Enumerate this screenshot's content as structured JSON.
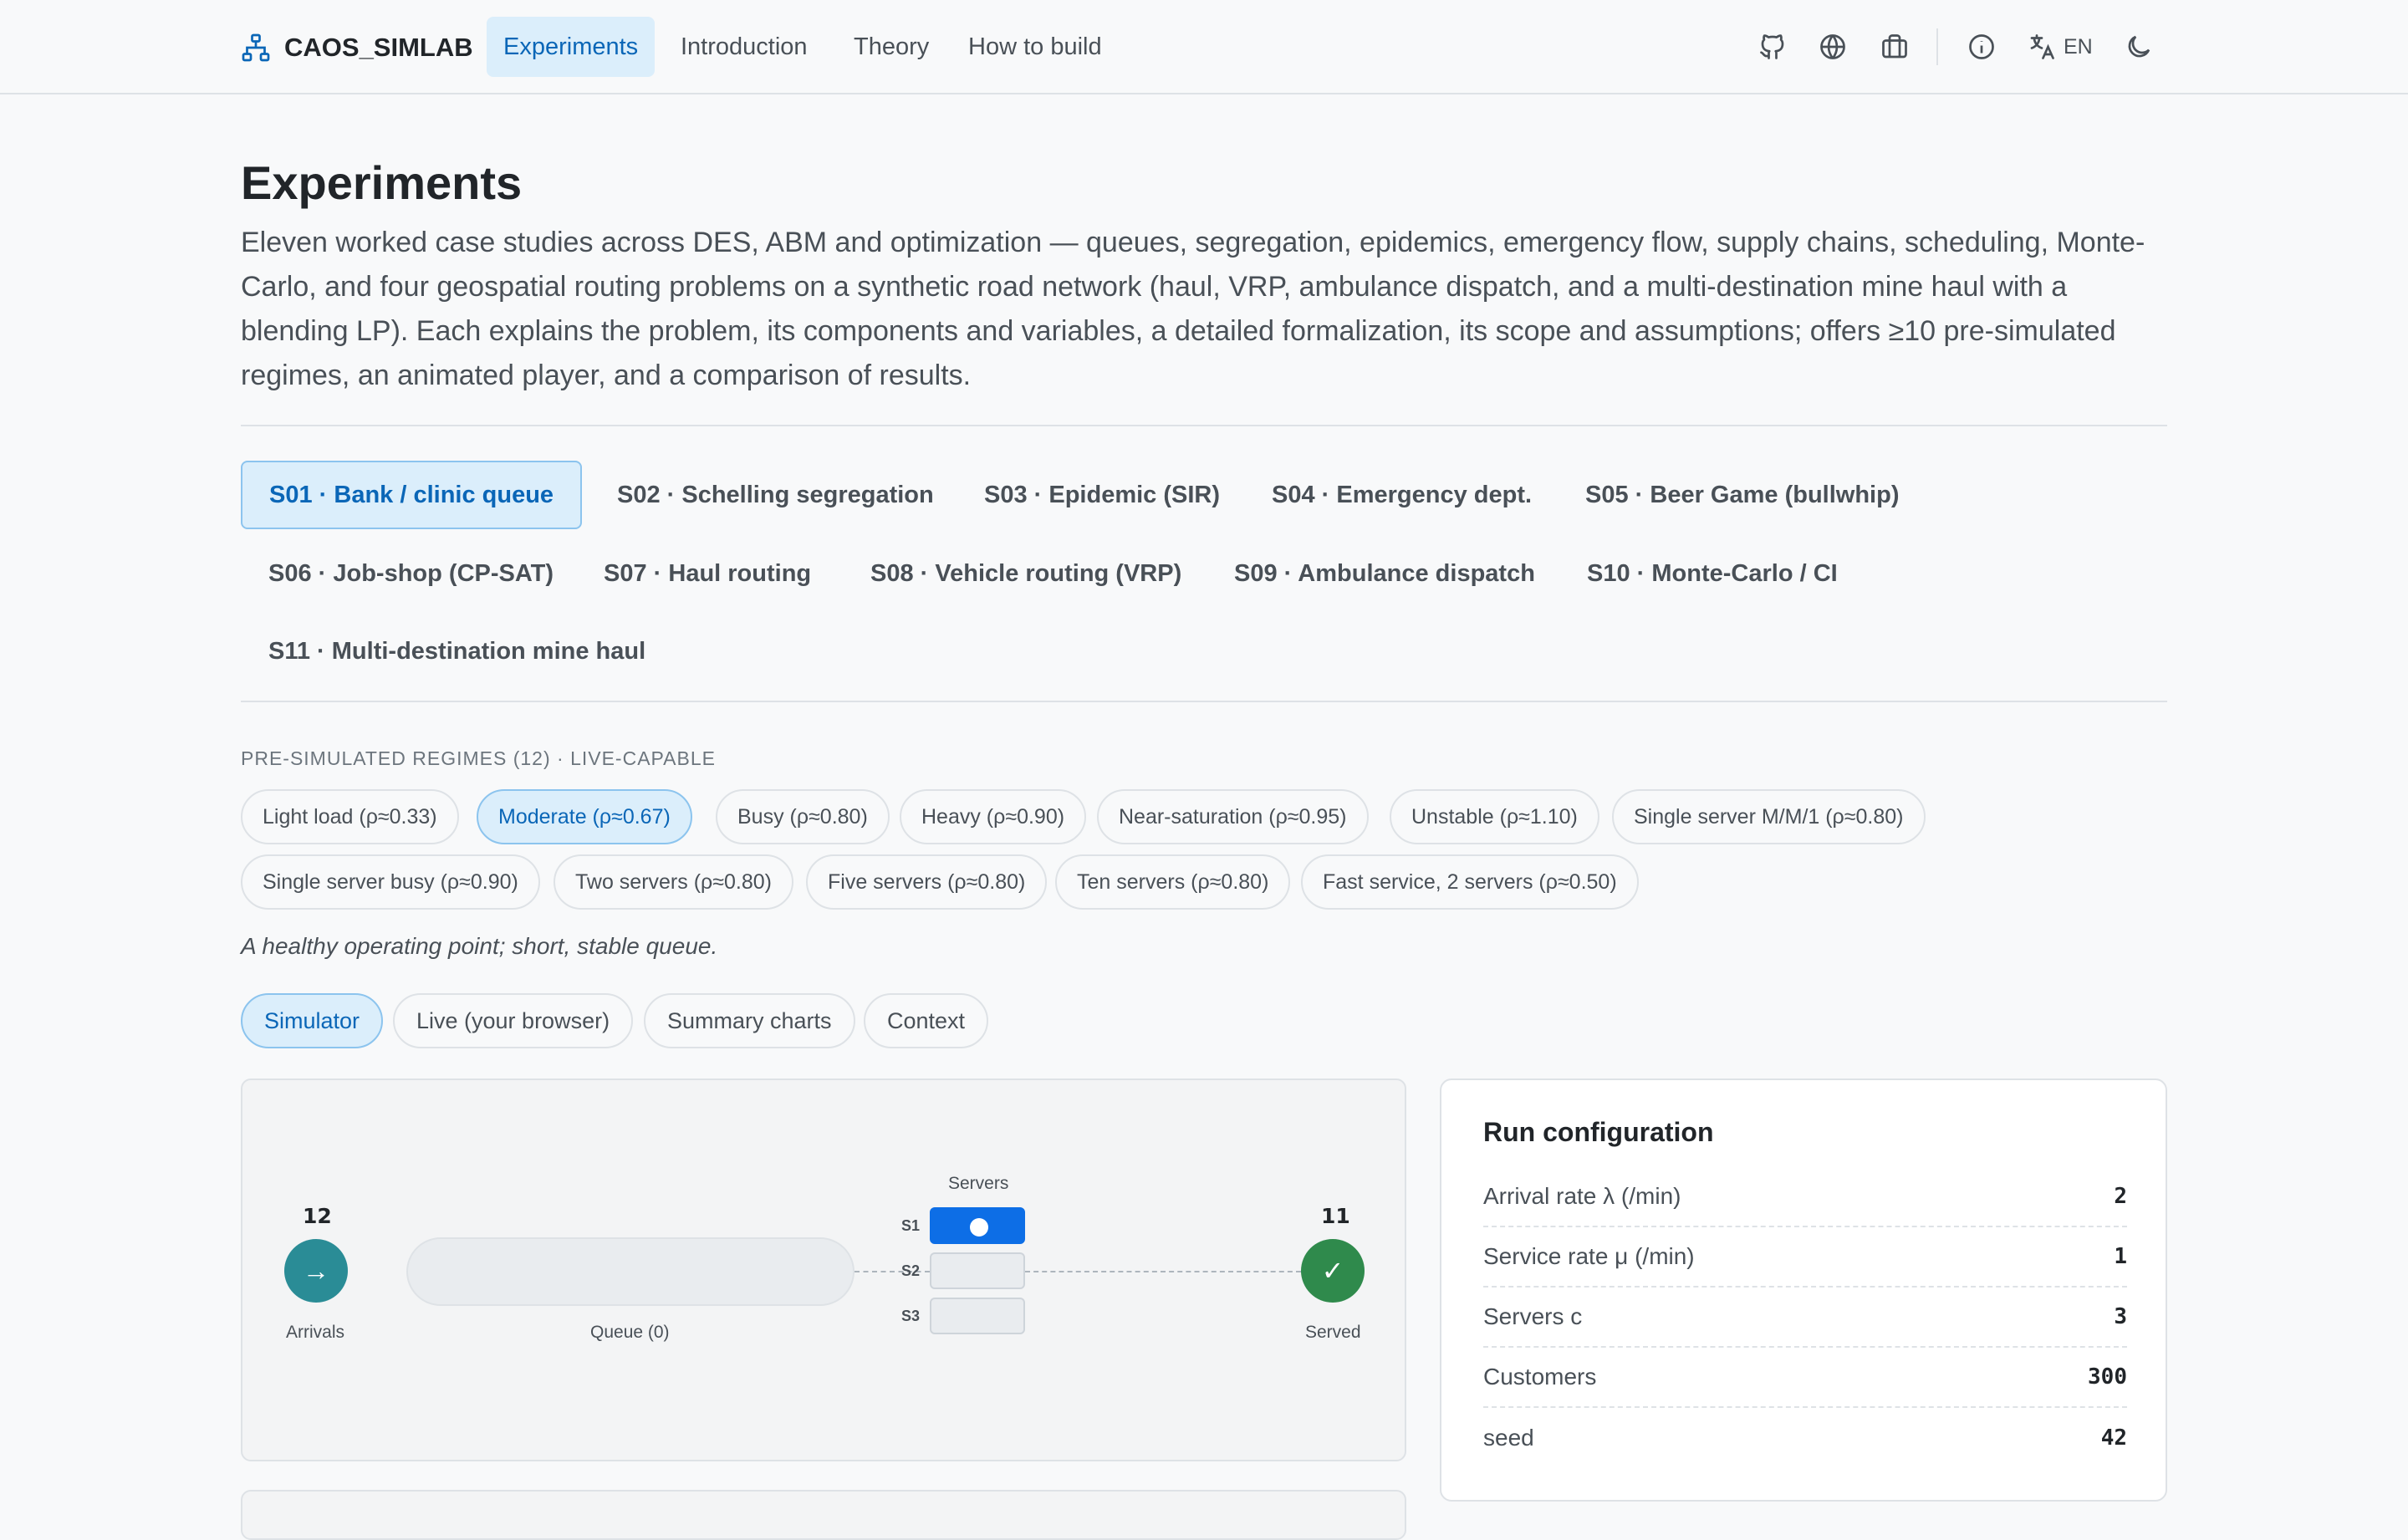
{
  "nav": {
    "brand": "CAOS_SIMLAB",
    "links": [
      "Experiments",
      "Introduction",
      "Theory",
      "How to build"
    ],
    "active_link": "Experiments",
    "icons": [
      "github-icon",
      "globe-icon",
      "briefcase-icon",
      "info-icon",
      "translate-icon",
      "moon-icon"
    ],
    "language": "EN"
  },
  "header": {
    "title": "Experiments",
    "intro": "Eleven worked case studies across DES, ABM and optimization — queues, segregation, epidemics, emergency flow, supply chains, scheduling, Monte-Carlo, and four geospatial routing problems on a synthetic road network (haul, VRP, ambulance dispatch, and a multi-destination mine haul with a blending LP). Each explains the problem, its components and variables, a detailed formalization, its scope and assumptions; offers ≥10 pre-simulated regimes, an animated player, and a comparison of results."
  },
  "scenarios": [
    "S01 · Bank / clinic queue",
    "S02 · Schelling segregation",
    "S03 · Epidemic (SIR)",
    "S04 · Emergency dept.",
    "S05 · Beer Game (bullwhip)",
    "S06 · Job-shop (CP-SAT)",
    "S07 · Haul routing",
    "S08 · Vehicle routing (VRP)",
    "S09 · Ambulance dispatch",
    "S10 · Monte-Carlo / CI",
    "S11 · Multi-destination mine haul"
  ],
  "active_scenario": "S01 · Bank / clinic queue",
  "regimes": {
    "label": "PRE-SIMULATED REGIMES (12) · LIVE-CAPABLE",
    "items": [
      "Light load (ρ≈0.33)",
      "Moderate (ρ≈0.67)",
      "Busy (ρ≈0.80)",
      "Heavy (ρ≈0.90)",
      "Near-saturation (ρ≈0.95)",
      "Unstable (ρ≈1.10)",
      "Single server M/M/1 (ρ≈0.80)",
      "Single server busy (ρ≈0.90)",
      "Two servers (ρ≈0.80)",
      "Five servers (ρ≈0.80)",
      "Ten servers (ρ≈0.80)",
      "Fast service, 2 servers (ρ≈0.50)"
    ],
    "active": "Moderate (ρ≈0.67)",
    "description": "A healthy operating point; short, stable queue."
  },
  "view_tabs": [
    "Simulator",
    "Live (your browser)",
    "Summary charts",
    "Context"
  ],
  "active_view_tab": "Simulator",
  "simulator": {
    "arrivals_count": "12",
    "arrivals_label": "Arrivals",
    "arrivals_icon": "→",
    "queue_label": "Queue (0)",
    "servers_title": "Servers",
    "servers": [
      {
        "label": "S1",
        "busy": true
      },
      {
        "label": "S2",
        "busy": false
      },
      {
        "label": "S3",
        "busy": false
      }
    ],
    "served_count": "11",
    "served_label": "Served",
    "served_icon": "✓",
    "colors": {
      "arrivals": "#2a8c96",
      "served": "#2f8a4c",
      "busy_server": "#0d6ee6"
    }
  },
  "run_config": {
    "title": "Run configuration",
    "rows": [
      {
        "label": "Arrival rate λ (/min)",
        "value": "2"
      },
      {
        "label": "Service rate μ (/min)",
        "value": "1"
      },
      {
        "label": "Servers c",
        "value": "3"
      },
      {
        "label": "Customers",
        "value": "300"
      },
      {
        "label": "seed",
        "value": "42"
      }
    ]
  }
}
